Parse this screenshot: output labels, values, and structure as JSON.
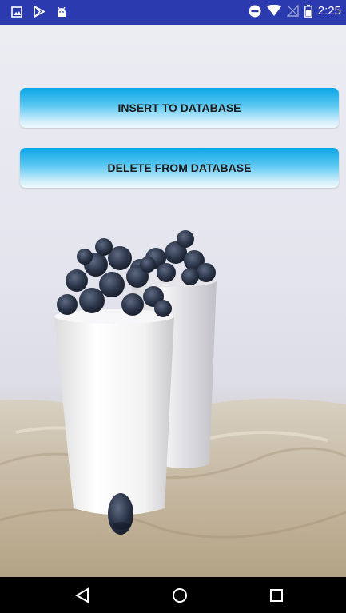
{
  "status_bar": {
    "time": "2:25",
    "left_icons": [
      "image-icon",
      "play-store-icon",
      "android-icon"
    ],
    "right_icons": [
      "do-not-disturb-icon",
      "wifi-icon",
      "no-signal-icon",
      "battery-icon"
    ],
    "background": "#2c3ab0"
  },
  "main": {
    "insert_button_label": "INSERT TO DATABASE",
    "delete_button_label": "DELETE FROM DATABASE",
    "background_image": "blueberries-in-white-cups"
  },
  "navigation_bar": {
    "buttons": [
      "back",
      "home",
      "recents"
    ]
  }
}
